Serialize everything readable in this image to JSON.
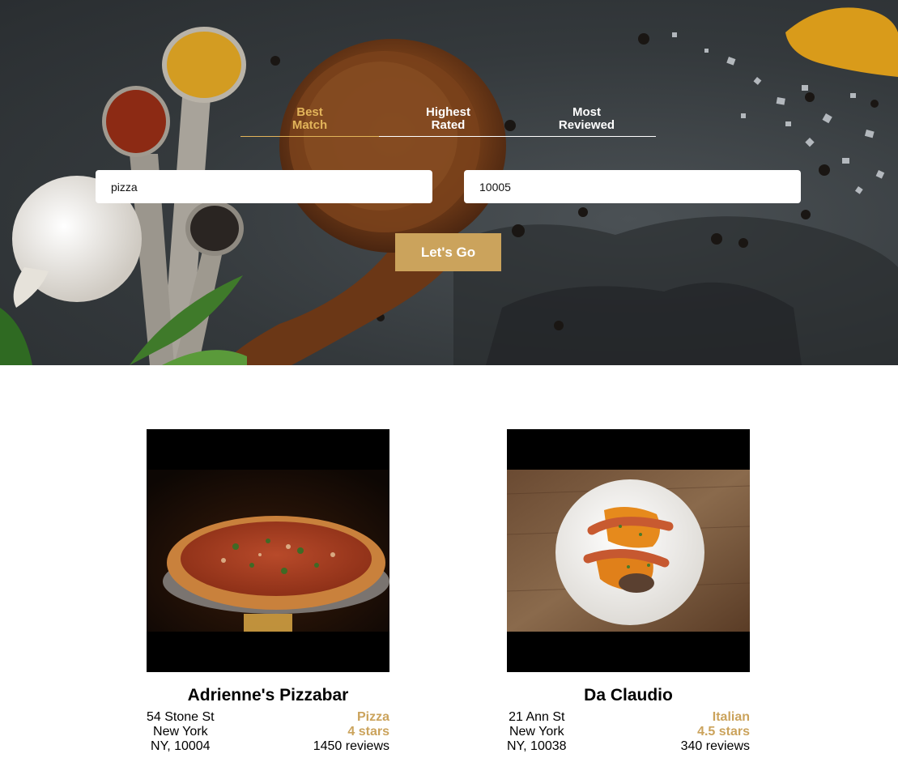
{
  "search": {
    "sort_options": [
      "Best Match",
      "Highest Rated",
      "Most Reviewed"
    ],
    "active_sort": "Best Match",
    "term_value": "pizza",
    "location_value": "10005",
    "submit_label": "Let's Go"
  },
  "businesses": [
    {
      "name": "Adrienne's Pizzabar",
      "address": "54 Stone St",
      "city": "New York",
      "state_zip": "NY, 10004",
      "category": "Pizza",
      "rating": "4 stars",
      "reviews": "1450 reviews"
    },
    {
      "name": "Da Claudio",
      "address": "21 Ann St",
      "city": "New York",
      "state_zip": "NY, 10038",
      "category": "Italian",
      "rating": "4.5 stars",
      "reviews": "340 reviews"
    }
  ],
  "colors": {
    "accent": "#cba35c",
    "active_tab": "#e2b45a"
  }
}
